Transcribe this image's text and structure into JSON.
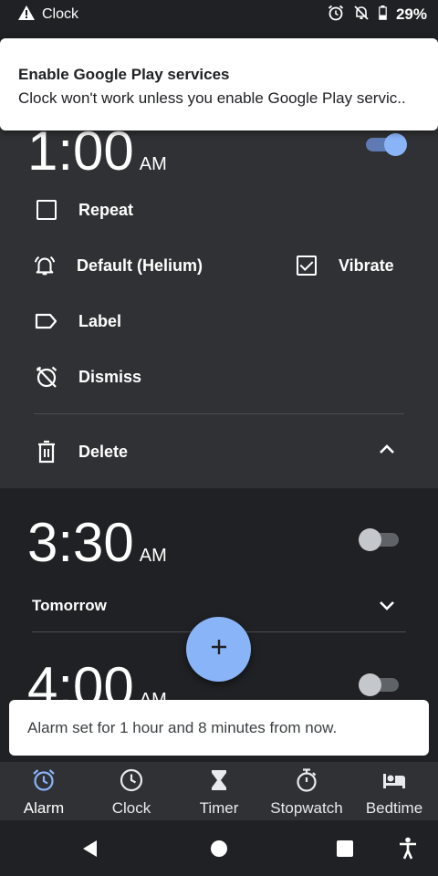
{
  "status_bar": {
    "app_name": "Clock",
    "battery": "29%",
    "icons": [
      "warning-icon",
      "alarm-icon",
      "notifications-off-icon",
      "battery-icon"
    ]
  },
  "notification": {
    "title": "Enable Google Play services",
    "body": "Clock won't work unless you enable Google Play servic.."
  },
  "alarm_expanded": {
    "time": "1:00",
    "ampm": "AM",
    "enabled": true,
    "repeat_label": "Repeat",
    "repeat_checked": false,
    "ringtone_label": "Default (Helium)",
    "vibrate_label": "Vibrate",
    "vibrate_checked": true,
    "label_label": "Label",
    "dismiss_label": "Dismiss",
    "delete_label": "Delete"
  },
  "alarms": [
    {
      "time": "3:30",
      "ampm": "AM",
      "enabled": false,
      "day": "Tomorrow"
    },
    {
      "time": "4:00",
      "ampm": "AM",
      "enabled": false
    }
  ],
  "toast": {
    "message": "Alarm set for 1 hour and 8 minutes from now."
  },
  "bottom_nav": {
    "items": [
      {
        "label": "Alarm",
        "icon": "alarm-icon",
        "active": true
      },
      {
        "label": "Clock",
        "icon": "clock-icon",
        "active": false
      },
      {
        "label": "Timer",
        "icon": "hourglass-icon",
        "active": false
      },
      {
        "label": "Stopwatch",
        "icon": "stopwatch-icon",
        "active": false
      },
      {
        "label": "Bedtime",
        "icon": "bed-icon",
        "active": false
      }
    ]
  },
  "colors": {
    "accent": "#8ab4f8",
    "background": "#202124",
    "card": "#303134"
  }
}
